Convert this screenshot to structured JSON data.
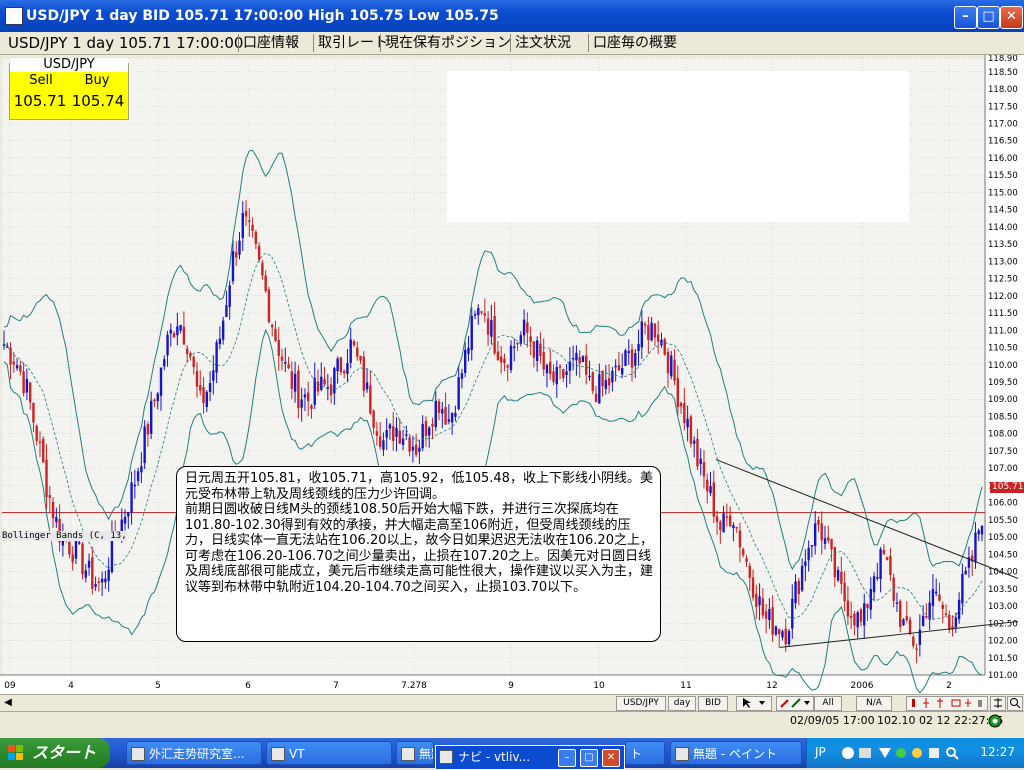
{
  "window": {
    "title": "USD/JPY 1 day BID 105.71 17:00:00 High 105.75 Low 105.75",
    "minimize": "–",
    "maximize": "□",
    "close": "✕"
  },
  "toolbar": {
    "label": "USD/JPY 1 day 105.71 17:00:00",
    "tabs": [
      "口座情報",
      "取引レート",
      "現在保有ポジション",
      "注文状況",
      "口座毎の概要"
    ]
  },
  "quote": {
    "title": "USD/JPY",
    "sell_label": "Sell",
    "buy_label": "Buy",
    "sell_value": "105.71",
    "buy_value": "105.74"
  },
  "indicator_label": "Bollinger Bands (C, 13,",
  "price_tag": "105.71",
  "comment": "日元周五开105.81，收105.71，高105.92，低105.48，收上下影线小阴线。美元受布林带上轨及周线颈线的压力少许回调。\n前期日圆收破日线M头的颈线108.50后开始大幅下跌，并进行三次探底均在101.80-102.30得到有效的承接，并大幅走高至106附近，但受周线颈线的压力，日线实体一直无法站在106.20以上，故今日如果迟迟无法收在106.20之上，可考虑在106.20-106.70之间少量卖出，止损在107.20之上。因美元对日圆日线及周线底部很可能成立，美元后市继续走高可能性很大，操作建议以买入为主，建议等到布林带中轨附近104.20-104.70之间买入，止损103.70以下。",
  "chart_data": {
    "type": "line",
    "title": "",
    "xlabel": "",
    "ylabel": "",
    "ylim": [
      101.0,
      118.9
    ],
    "y_ticks": [
      "118.90",
      "118.50",
      "118.00",
      "117.50",
      "117.00",
      "116.50",
      "116.00",
      "115.50",
      "115.00",
      "114.50",
      "114.00",
      "113.50",
      "113.00",
      "112.50",
      "112.00",
      "111.50",
      "111.00",
      "110.50",
      "110.00",
      "109.50",
      "109.00",
      "108.50",
      "108.00",
      "107.50",
      "107.00",
      "106.50",
      "106.00",
      "105.50",
      "105.00",
      "104.50",
      "104.00",
      "103.50",
      "103.00",
      "102.50",
      "102.00",
      "101.50",
      "101.00"
    ],
    "x_ticks": [
      "09",
      "4",
      "5",
      "6",
      "7",
      "7.278",
      "9",
      "10",
      "11",
      "12",
      "2006",
      "2"
    ],
    "price_path": [
      110.6,
      110.2,
      109.4,
      108.0,
      106.4,
      105.2,
      104.8,
      104.4,
      103.8,
      103.6,
      104.8,
      105.6,
      106.6,
      107.9,
      109.2,
      110.6,
      111.4,
      110.6,
      108.8,
      109.5,
      111.0,
      113.0,
      114.2,
      113.4,
      112.2,
      110.8,
      109.8,
      109.2,
      109.0,
      109.3,
      109.4,
      110.0,
      110.6,
      109.6,
      108.6,
      107.7,
      108.2,
      108.0,
      107.6,
      108.4,
      109.0,
      108.4,
      109.6,
      111.0,
      111.8,
      110.8,
      110.2,
      110.6,
      111.0,
      110.4,
      109.6,
      109.5,
      109.9,
      110.0,
      109.3,
      109.3,
      109.6,
      110.0,
      110.4,
      111.0,
      111.1,
      110.3,
      109.2,
      108.2,
      107.0,
      106.2,
      105.2,
      105.8,
      104.6,
      103.6,
      102.6,
      102.5,
      102.3,
      103.6,
      104.8,
      105.4,
      104.4,
      103.4,
      102.9,
      102.4,
      104.0,
      104.4,
      103.2,
      102.2,
      101.9,
      103.2,
      103.2,
      102.4,
      103.4,
      104.2,
      105.7
    ],
    "series": [
      {
        "name": ""
      },
      {
        "name": ""
      },
      {
        "name": ""
      }
    ],
    "trendlines": [
      {
        "from": [
          "11",
          107.25
        ],
        "to": [
          "end",
          103.8
        ]
      },
      {
        "from": [
          "12",
          101.8
        ],
        "to": [
          "end",
          102.55
        ]
      }
    ],
    "horizontal_line": 105.71,
    "grid": true
  },
  "nav": {
    "scroll_left": "◀",
    "buttons": [
      "USD/JPY",
      "day",
      "BID",
      "All",
      "N/A"
    ]
  },
  "status": {
    "time": "02/09/05 17:00",
    "clock": "102.10 02 12 22:27:05"
  },
  "taskbar": {
    "start": "スタート",
    "items": [
      "外汇走势研究室...",
      "VT",
      "無題",
      "ナビ - vtliv...",
      "ト",
      "無題 - ペイント"
    ],
    "lang": "JP",
    "clock": "12:27"
  },
  "colors": {
    "up_candle": "#1515c8",
    "down_candle": "#cc2222",
    "band": "#208080",
    "grid": "#c8c8c8",
    "horizontal_line": "#aa2222",
    "trendline": "#222222"
  }
}
